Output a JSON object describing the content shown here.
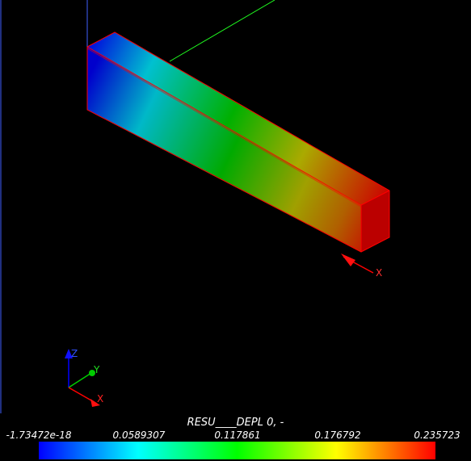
{
  "result": {
    "field_title": "RESU____DEPL 0, -"
  },
  "colorbar": {
    "ticks": [
      "-1.73472e-18",
      "0.0589307",
      "0.117861",
      "0.176792",
      "0.235723"
    ],
    "colors": [
      "#0000ff",
      "#00ffff",
      "#00ff00",
      "#ffff00",
      "#ff0000"
    ]
  },
  "axes": {
    "x_label": "X",
    "y_label": "Y",
    "z_label": "Z",
    "x_color": "#ff0000",
    "y_color": "#00ff00",
    "z_color": "#0000ff"
  },
  "beam": {
    "edge_color": "#ff0000",
    "axis_x_label": "X"
  }
}
